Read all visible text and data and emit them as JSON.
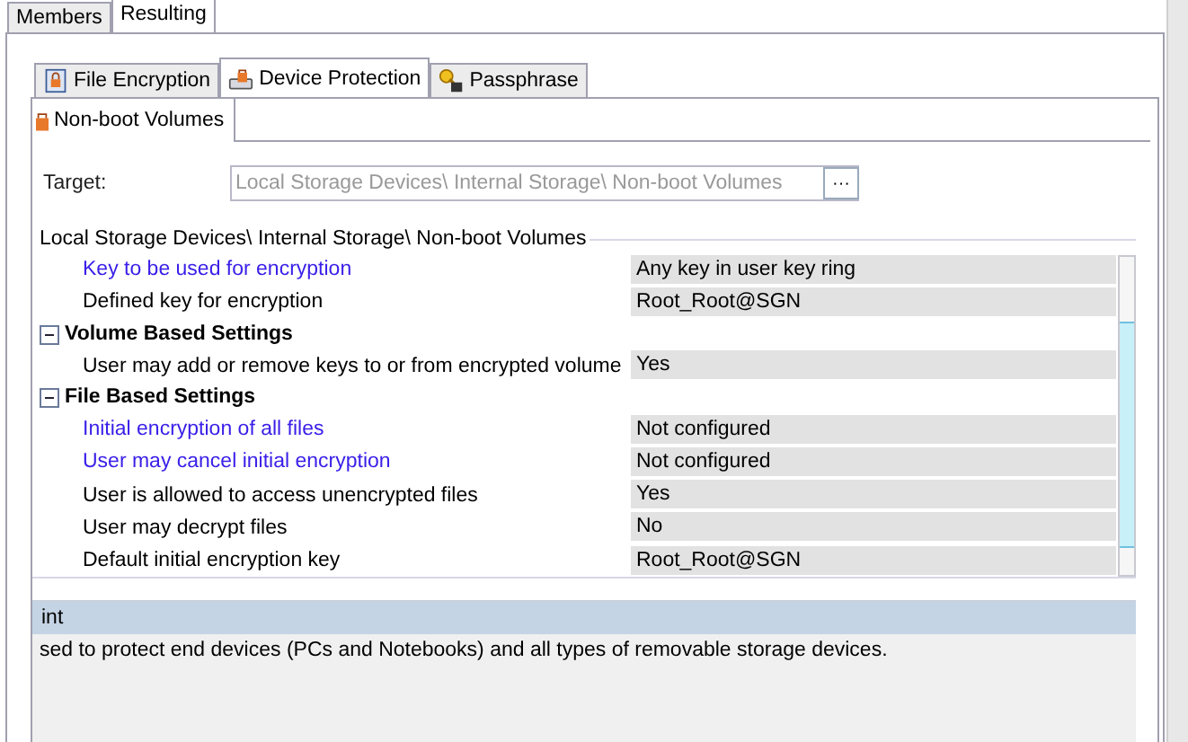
{
  "top_tabs": [
    {
      "label": "Members",
      "selected": false
    },
    {
      "label": "Resulting",
      "selected": true
    }
  ],
  "sub_tabs": [
    {
      "label": "File Encryption",
      "kind": "file",
      "selected": false
    },
    {
      "label": "Device Protection",
      "kind": "drive",
      "selected": true
    },
    {
      "label": "Passphrase",
      "kind": "keys",
      "selected": false
    }
  ],
  "inner_tabs": [
    {
      "label": "Non-boot Volumes",
      "selected": true
    }
  ],
  "target": {
    "label": "Target:",
    "value": "Local Storage Devices\\ Internal Storage\\ Non-boot Volumes",
    "browse": "···",
    "disabled": true
  },
  "section_title": "Local Storage Devices\\ Internal Storage\\ Non-boot Volumes",
  "settings": [
    {
      "kind": "setting",
      "name": "Key to be used for encryption",
      "value": "Any key in user key ring",
      "modified": true
    },
    {
      "kind": "setting",
      "name": "Defined key for encryption",
      "value": "Root_Root@SGN",
      "modified": false
    },
    {
      "kind": "group",
      "name": "Volume Based Settings",
      "expanded": true
    },
    {
      "kind": "setting",
      "name": "User may add or remove keys to or from encrypted volume",
      "value": "Yes",
      "modified": false
    },
    {
      "kind": "group",
      "name": "File Based Settings",
      "expanded": true
    },
    {
      "kind": "setting",
      "name": "Initial encryption of all files",
      "value": "Not configured",
      "modified": true
    },
    {
      "kind": "setting",
      "name": "User may cancel initial encryption",
      "value": "Not configured",
      "modified": true
    },
    {
      "kind": "setting",
      "name": "User is allowed to access unencrypted files",
      "value": "Yes",
      "modified": false
    },
    {
      "kind": "setting",
      "name": "User may decrypt files",
      "value": "No",
      "modified": false
    },
    {
      "kind": "setting",
      "name": "Default initial encryption key",
      "value": "Root_Root@SGN",
      "modified": false
    }
  ],
  "hint": {
    "title": "int",
    "text": "sed to protect end devices (PCs and Notebooks) and all types of removable storage devices."
  }
}
